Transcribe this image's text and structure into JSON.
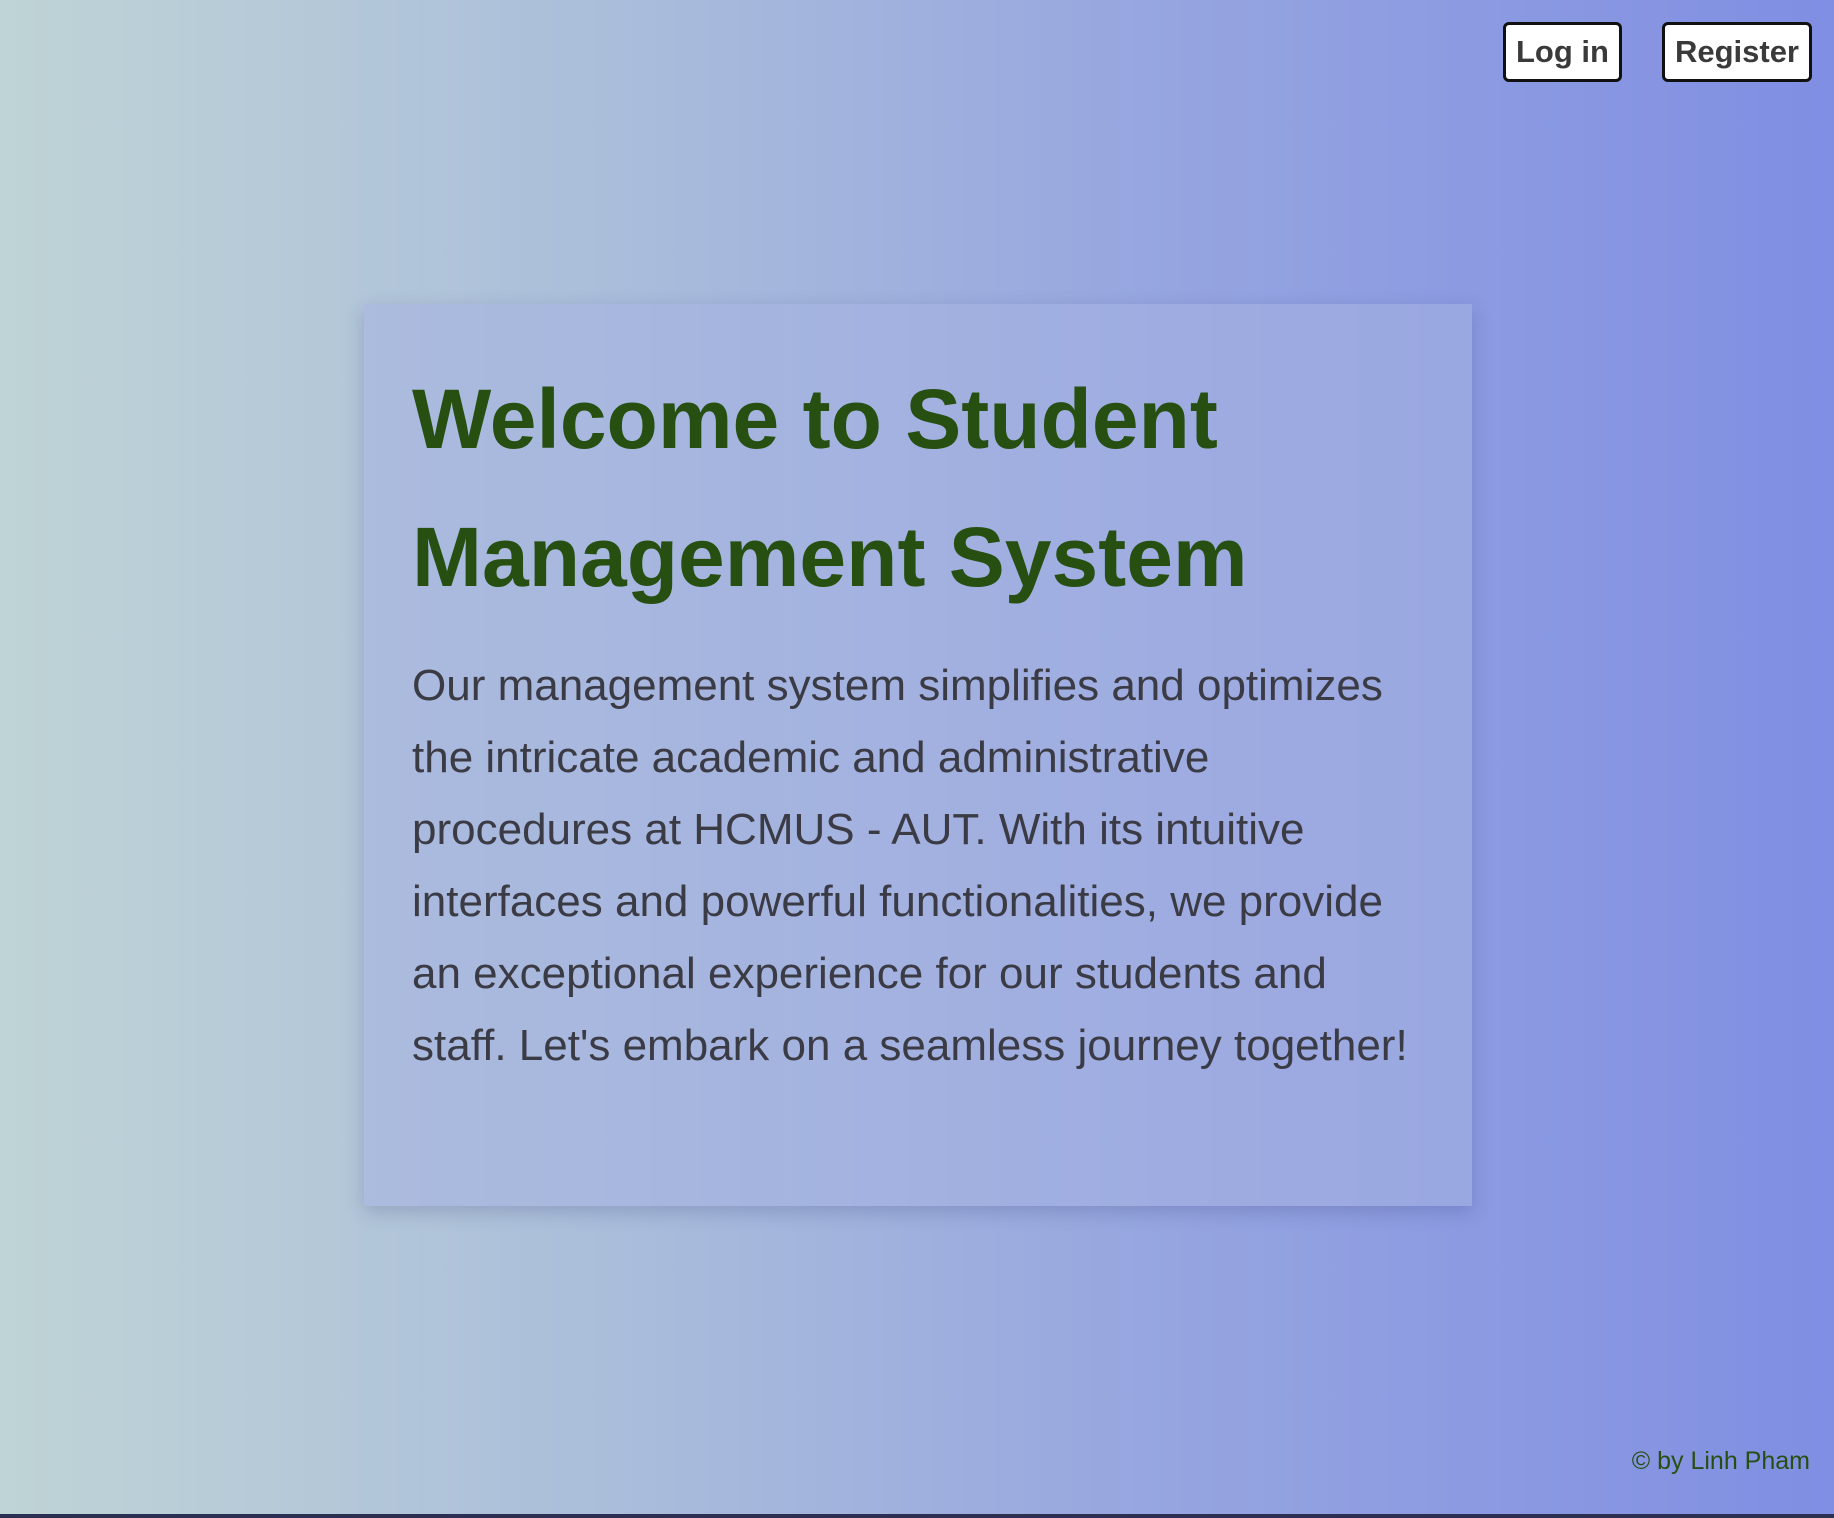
{
  "header": {
    "login_label": "Log in",
    "register_label": "Register"
  },
  "hero": {
    "title": "Welcome to Student Management System",
    "description": "Our management system simplifies and optimizes the intricate academic and administrative procedures at HCMUS - AUT. With its intuitive interfaces and powerful functionalities, we provide an exceptional experience for our students and staff. Let's embark on a seamless journey together!"
  },
  "footer": {
    "credit": "© by Linh Pham"
  },
  "colors": {
    "title": "#274f12",
    "body_text": "#3b3b45",
    "gradient_start": "#bfd4d6",
    "gradient_end": "#808ee3"
  }
}
